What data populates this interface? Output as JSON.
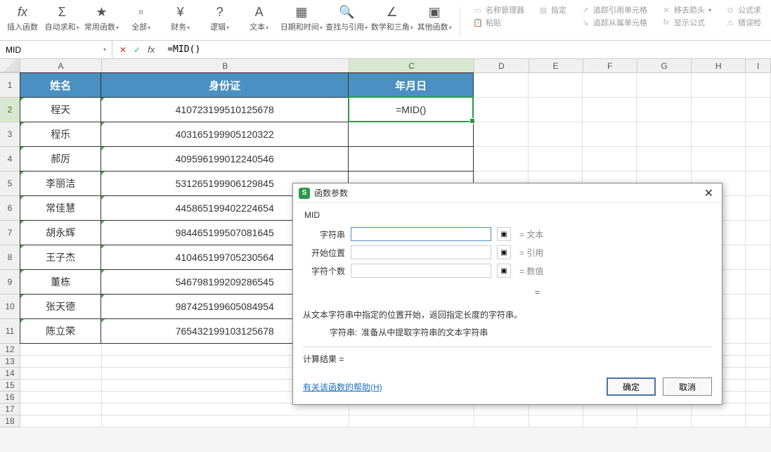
{
  "ribbon": {
    "insert_fn": "插入函数",
    "autosum": "自动求和",
    "common": "常用函数",
    "all": "全部",
    "finance": "财务",
    "logic": "逻辑",
    "text": "文本",
    "datetime": "日期和时间",
    "lookup": "查找与引用",
    "math": "数学和三角",
    "other": "其他函数",
    "name_mgr": "名称管理器",
    "paste": "粘贴",
    "define": "指定",
    "trace_prec": "追踪引用单元格",
    "trace_dep": "追踪从属单元格",
    "remove_arrows": "移去箭头",
    "show_formula": "显示公式",
    "formula_err": "公式求",
    "error_check": "错误检"
  },
  "fbar": {
    "namebox": "MID",
    "formula": "=MID()"
  },
  "columns": [
    "A",
    "B",
    "C",
    "D",
    "E",
    "F",
    "G",
    "H",
    "I"
  ],
  "headers": {
    "A": "姓名",
    "B": "身份证",
    "C": "年月日"
  },
  "active_cell_display": "=MID()",
  "chart_data": {
    "type": "table",
    "columns": [
      "姓名",
      "身份证",
      "年月日"
    ],
    "rows": [
      {
        "name": "程天",
        "id": "410723199510125678",
        "ymd": "=MID()"
      },
      {
        "name": "程乐",
        "id": "403165199905120322",
        "ymd": ""
      },
      {
        "name": "郝厉",
        "id": "409596199012240546",
        "ymd": ""
      },
      {
        "name": "李丽洁",
        "id": "531265199906129845",
        "ymd": ""
      },
      {
        "name": "常佳慧",
        "id": "445865199402224654",
        "ymd": ""
      },
      {
        "name": "胡永辉",
        "id": "984465199507081645",
        "ymd": ""
      },
      {
        "name": "王子杰",
        "id": "410465199705230564",
        "ymd": ""
      },
      {
        "name": "董栋",
        "id": "546798199209286545",
        "ymd": ""
      },
      {
        "name": "张天德",
        "id": "987425199605084954",
        "ymd": ""
      },
      {
        "name": "陈立荣",
        "id": "765432199103125678",
        "ymd": ""
      }
    ]
  },
  "dialog": {
    "title": "函数参数",
    "fn_name": "MID",
    "args": [
      {
        "label": "字符串",
        "type": "文本",
        "focus": true
      },
      {
        "label": "开始位置",
        "type": "引用",
        "focus": false
      },
      {
        "label": "字符个数",
        "type": "数值",
        "focus": false
      }
    ],
    "eq": "=",
    "description": "从文本字符串中指定的位置开始，返回指定长度的字符串。",
    "arg_name": "字符串:",
    "arg_detail": "准备从中提取字符串的文本字符串",
    "result_label": "计算结果 =",
    "help_link": "有关该函数的帮助(H)",
    "ok": "确定",
    "cancel": "取消"
  }
}
